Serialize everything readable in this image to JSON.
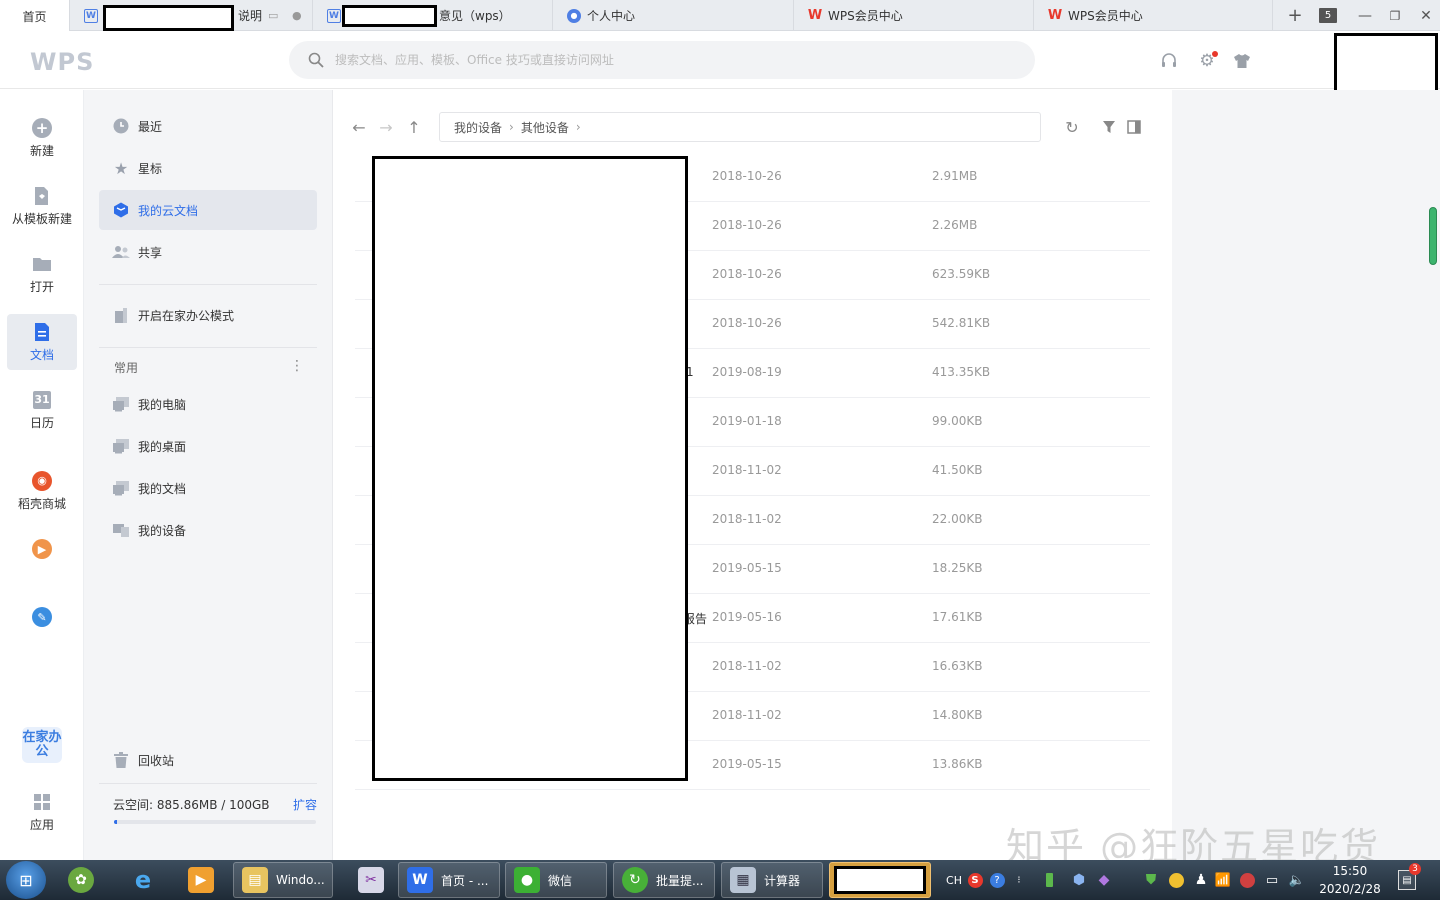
{
  "tabs": [
    {
      "label": "首页"
    },
    {
      "label": "说明"
    },
    {
      "label": "意见（wps）"
    },
    {
      "label": "个人中心"
    },
    {
      "label": "WPS会员中心"
    },
    {
      "label": "WPS会员中心"
    }
  ],
  "tab_count": "5",
  "header": {
    "logo": "WPS",
    "search_placeholder": "搜索文档、应用、模板、Office 技巧或直接访问网址"
  },
  "leftnav": {
    "items": [
      {
        "label": "新建"
      },
      {
        "label": "从模板新建"
      },
      {
        "label": "打开"
      },
      {
        "label": "文档"
      },
      {
        "label": "日历"
      },
      {
        "label": "稻壳商城"
      },
      {
        "label": "应用"
      }
    ],
    "promo": "在家办公",
    "calendar_day": "31"
  },
  "sidebar": {
    "items": [
      {
        "label": "最近"
      },
      {
        "label": "星标"
      },
      {
        "label": "我的云文档"
      },
      {
        "label": "共享"
      }
    ],
    "home_office": "开启在家办公模式",
    "frequent_label": "常用",
    "more": "⋮",
    "frequent": [
      {
        "label": "我的电脑"
      },
      {
        "label": "我的桌面"
      },
      {
        "label": "我的文档"
      },
      {
        "label": "我的设备"
      }
    ],
    "recycle": "回收站",
    "quota": "云空间: 885.86MB / 100GB",
    "expand": "扩容",
    "quota_fraction": 0.0089
  },
  "main": {
    "breadcrumb": [
      "我的设备",
      "其他设备"
    ],
    "files": [
      {
        "name_tail": "",
        "date": "2018-10-26",
        "size": "2.91MB"
      },
      {
        "name_tail": "",
        "date": "2018-10-26",
        "size": "2.26MB"
      },
      {
        "name_tail": "",
        "date": "2018-10-26",
        "size": "623.59KB"
      },
      {
        "name_tail": "",
        "date": "2018-10-26",
        "size": "542.81KB"
      },
      {
        "name_tail": "1",
        "date": "2019-08-19",
        "size": "413.35KB"
      },
      {
        "name_tail": "",
        "date": "2019-01-18",
        "size": "99.00KB"
      },
      {
        "name_tail": "",
        "date": "2018-11-02",
        "size": "41.50KB"
      },
      {
        "name_tail": "",
        "date": "2018-11-02",
        "size": "22.00KB"
      },
      {
        "name_tail": "",
        "date": "2019-05-15",
        "size": "18.25KB"
      },
      {
        "name_tail": "报告",
        "date": "2019-05-16",
        "size": "17.61KB"
      },
      {
        "name_tail": "",
        "date": "2018-11-02",
        "size": "16.63KB"
      },
      {
        "name_tail": "",
        "date": "2018-11-02",
        "size": "14.80KB"
      },
      {
        "name_tail": "",
        "date": "2019-05-15",
        "size": "13.86KB"
      }
    ]
  },
  "taskbar": {
    "apps": [
      {
        "label": "Windo..."
      },
      {
        "label": "首页 - ..."
      },
      {
        "label": "微信"
      },
      {
        "label": "批量提..."
      },
      {
        "label": "计算器"
      }
    ],
    "ime": "CH",
    "time": "15:50",
    "date": "2020/2/28",
    "notifications": "3"
  },
  "watermark": "知乎 @狂阶五星吃货",
  "colors": {
    "accent": "#2f6ee8",
    "wps_red": "#e8382c",
    "sidebar_bg": "#f4f5f7"
  }
}
